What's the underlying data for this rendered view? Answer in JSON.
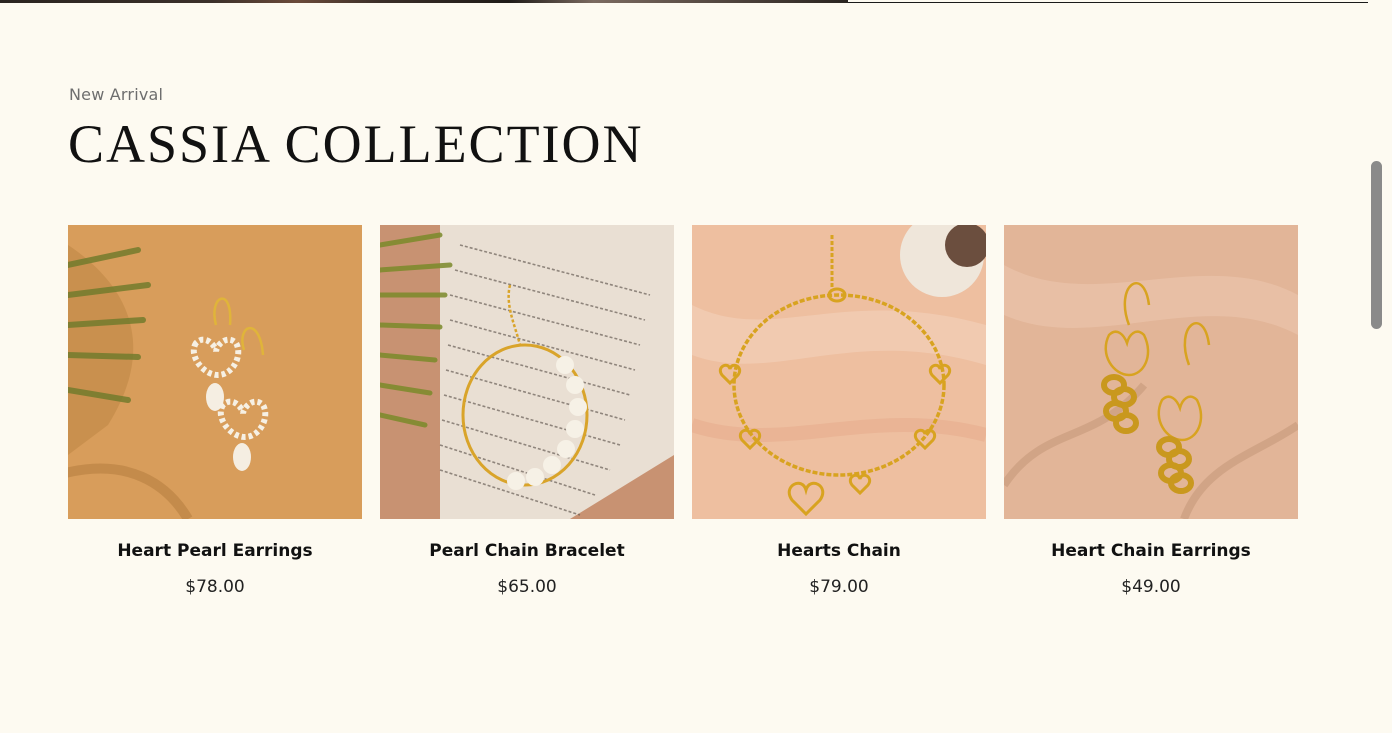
{
  "section": {
    "eyebrow": "New Arrival",
    "title": "CASSIA COLLECTION"
  },
  "products": [
    {
      "name": "Heart Pearl Earrings",
      "price": "$78.00",
      "image_icon": "heart-pearl-earrings-image"
    },
    {
      "name": "Pearl Chain Bracelet",
      "price": "$65.00",
      "image_icon": "pearl-chain-bracelet-image"
    },
    {
      "name": "Hearts Chain",
      "price": "$79.00",
      "image_icon": "hearts-chain-image"
    },
    {
      "name": "Heart Chain Earrings",
      "price": "$49.00",
      "image_icon": "heart-chain-earrings-image"
    }
  ],
  "colors": {
    "background": "#fdfaf1",
    "gold": "#d4a22a",
    "text": "#111111"
  }
}
